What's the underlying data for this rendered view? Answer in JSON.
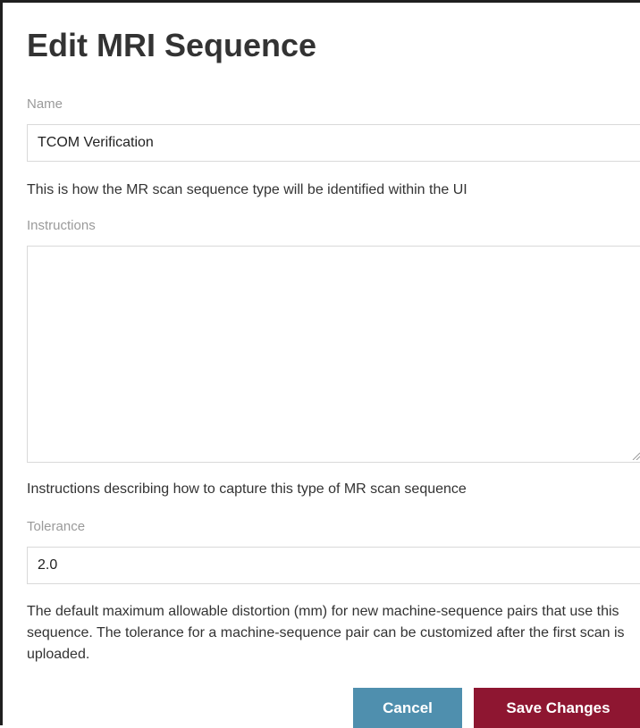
{
  "page": {
    "title": "Edit MRI Sequence"
  },
  "form": {
    "name": {
      "label": "Name",
      "value": "TCOM Verification",
      "help": "This is how the MR scan sequence type will be identified within the UI"
    },
    "instructions": {
      "label": "Instructions",
      "value": "",
      "help": "Instructions describing how to capture this type of MR scan sequence"
    },
    "tolerance": {
      "label": "Tolerance",
      "value": "2.0",
      "help": "The default maximum allowable distortion (mm) for new machine-sequence pairs that use this sequence. The tolerance for a machine-sequence pair can be customized after the first scan is uploaded."
    }
  },
  "actions": {
    "cancel_label": "Cancel",
    "save_label": "Save Changes"
  },
  "colors": {
    "cancel": "#4f8fae",
    "save": "#8e1631"
  }
}
